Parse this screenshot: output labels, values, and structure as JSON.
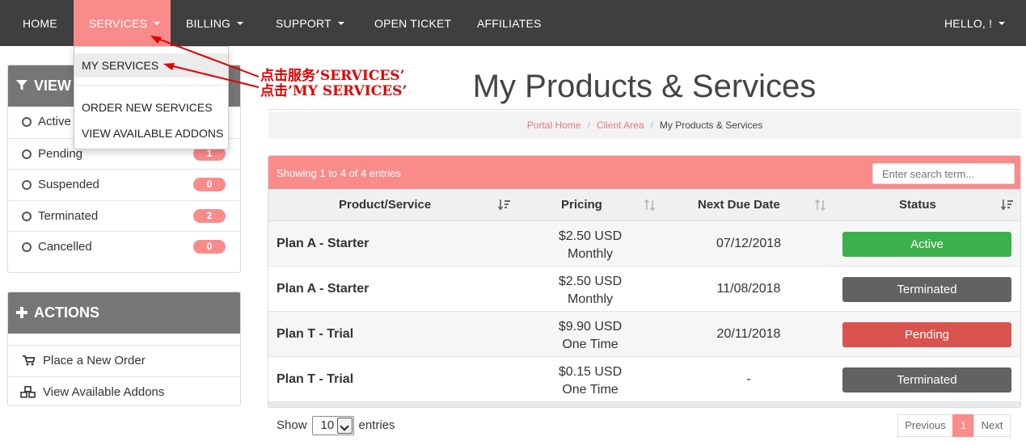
{
  "nav": {
    "home": "HOME",
    "services": "SERVICES",
    "billing": "BILLING",
    "support": "SUPPORT",
    "open_ticket": "OPEN TICKET",
    "affiliates": "AFFILIATES",
    "user": "HELLO, !"
  },
  "dropdown": {
    "items": [
      "MY SERVICES",
      "ORDER NEW SERVICES",
      "VIEW AVAILABLE ADDONS"
    ]
  },
  "annotations": {
    "line1": "点击服务’SERVICES’",
    "line2": "点击’MY SERVICES’",
    "color": "#e00000"
  },
  "sidebar": {
    "view": {
      "title": "VIEW",
      "filters": [
        {
          "label": "Active",
          "count": ""
        },
        {
          "label": "Pending",
          "count": "1"
        },
        {
          "label": "Suspended",
          "count": "0"
        },
        {
          "label": "Terminated",
          "count": "2"
        },
        {
          "label": "Cancelled",
          "count": "0"
        }
      ]
    },
    "actions": {
      "title": "ACTIONS",
      "items": [
        "Place a New Order",
        "View Available Addons"
      ]
    }
  },
  "page": {
    "title": "My Products & Services",
    "breadcrumb": [
      "Portal Home",
      "Client Area",
      "My Products & Services"
    ]
  },
  "table": {
    "showing": "Showing 1 to 4 of 4 entries",
    "search_placeholder": "Enter search term...",
    "columns": [
      "Product/Service",
      "Pricing",
      "Next Due Date",
      "Status"
    ],
    "rows": [
      {
        "name": "Plan A - Starter",
        "price": "$2.50 USD",
        "cycle": "Monthly",
        "due": "07/12/2018",
        "status": "Active"
      },
      {
        "name": "Plan A - Starter",
        "price": "$2.50 USD",
        "cycle": "Monthly",
        "due": "11/08/2018",
        "status": "Terminated"
      },
      {
        "name": "Plan T - Trial",
        "price": "$9.90 USD",
        "cycle": "One Time",
        "due": "20/11/2018",
        "status": "Pending"
      },
      {
        "name": "Plan T - Trial",
        "price": "$0.15 USD",
        "cycle": "One Time",
        "due": "-",
        "status": "Terminated"
      }
    ],
    "show_label": "Show",
    "page_size": "10",
    "entries_label": "entries",
    "pagination": [
      "Previous",
      "1",
      "Next"
    ]
  },
  "colors": {
    "nav_bg": "#3f3f3f",
    "accent": "#f98b8b",
    "active": "#3cb04a",
    "terminated": "#626262",
    "pending": "#d9534f",
    "panel_head": "#767676"
  }
}
